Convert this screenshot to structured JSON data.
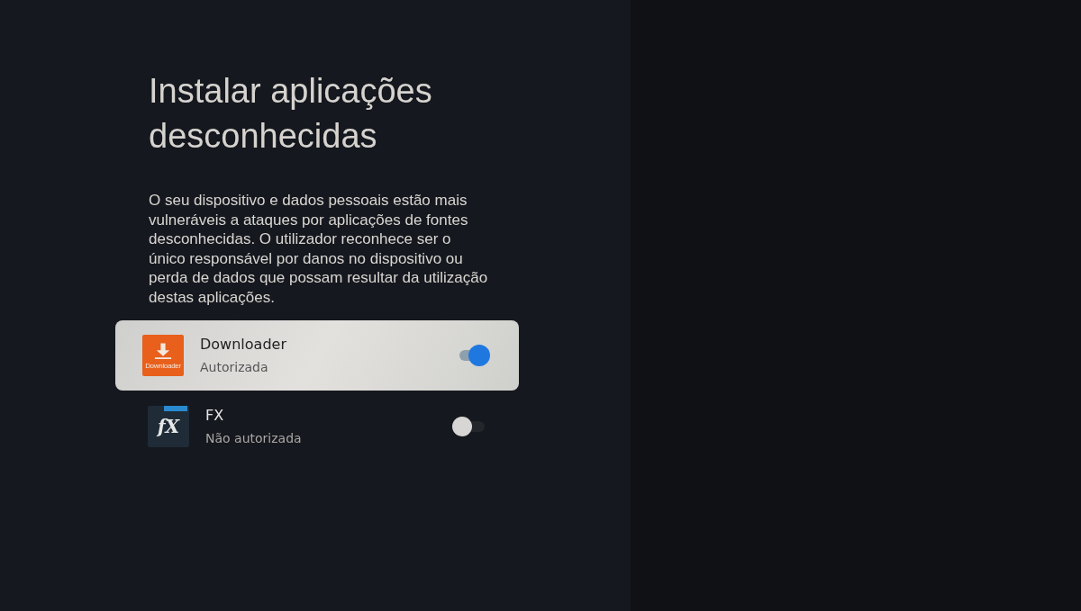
{
  "title": "Instalar aplicações desconhecidas",
  "description": "O seu dispositivo e dados pessoais estão mais vulneráveis a ataques por aplicações de fontes desconhecidas. O utilizador reconhece ser o único responsável por danos no dispositivo ou perda de dados que possam resultar da utilização destas aplicações.",
  "apps": [
    {
      "name": "Downloader",
      "status": "Autorizada",
      "kind": "download",
      "icon_text": "Downloader",
      "selected": true,
      "on": true
    },
    {
      "name": "FX",
      "status": "Não autorizada",
      "kind": "fx",
      "icon_text": "fX",
      "selected": false,
      "on": false
    }
  ]
}
